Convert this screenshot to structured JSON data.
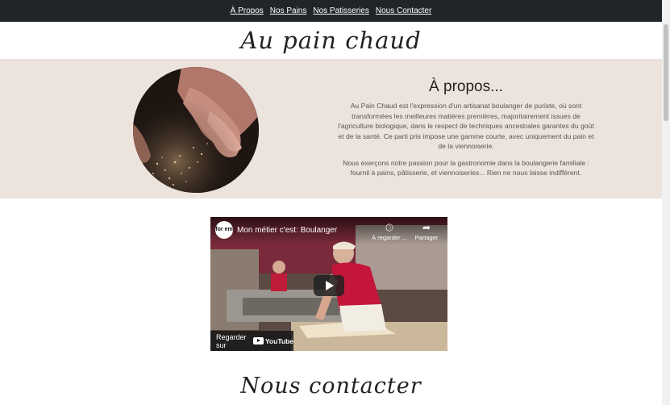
{
  "nav": {
    "items": [
      {
        "label": "À Propos"
      },
      {
        "label": "Nos Pains"
      },
      {
        "label": "Nos Patisseries"
      },
      {
        "label": "Nous Contacter"
      }
    ]
  },
  "brand": {
    "title": "Au pain chaud"
  },
  "about": {
    "title": "À propos...",
    "paragraph1": "Au Pain Chaud est l'expression d'un artisanat boulanger de puriste, où sont transformées les meilleures matières premières, majoritairement issues de l'agriculture biologique, dans le respect de techniques ancestrales garantes du goût et de la santé. Ce parti pris impose une gamme courte, avec uniquement du pain et de la viennoiserie.",
    "paragraph2": "Nous exerçons notre passion pour la gastronomie dans la boulangerie familiale : fournil à pains, pâtisserie, et viennoiseries... Rien ne nous laisse indifférent."
  },
  "video": {
    "channel_badge": "for em",
    "title": "Mon métier c'est: Boulanger",
    "watch_later_label": "À regarder ...",
    "share_label": "Partager",
    "watch_on_label": "Regarder sur",
    "youtube_label": "YouTube"
  },
  "contact": {
    "title": "Nous contacter"
  },
  "colors": {
    "nav_bg": "#212529",
    "about_bg": "#ede3dd",
    "page_bg": "#ffffff"
  }
}
